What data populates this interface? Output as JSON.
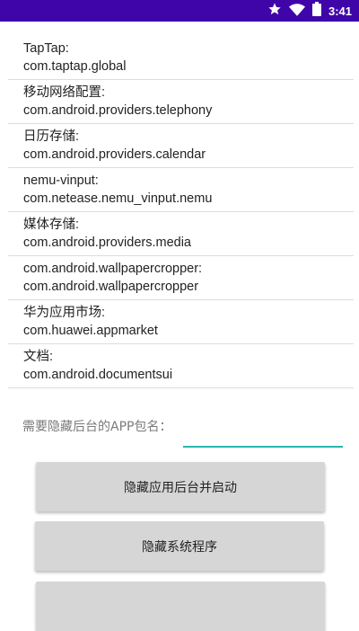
{
  "status_bar": {
    "time": "3:41",
    "color": "#3f05a8",
    "icons": [
      "star-icon",
      "wifi-icon",
      "battery-icon"
    ]
  },
  "apps": [
    {
      "label": "TapTap:",
      "package": "com.taptap.global"
    },
    {
      "label": "移动网络配置:",
      "package": "com.android.providers.telephony"
    },
    {
      "label": "日历存储:",
      "package": "com.android.providers.calendar"
    },
    {
      "label": "nemu-vinput:",
      "package": "com.netease.nemu_vinput.nemu"
    },
    {
      "label": "媒体存储:",
      "package": "com.android.providers.media"
    },
    {
      "label": "com.android.wallpapercropper:",
      "package": "com.android.wallpapercropper"
    },
    {
      "label": "华为应用市场:",
      "package": "com.huawei.appmarket"
    },
    {
      "label": "文档:",
      "package": "com.android.documentsui"
    }
  ],
  "form": {
    "package_label": "需要隐藏后台的APP包名：",
    "package_value": "",
    "accent": "#28b7ad"
  },
  "buttons": {
    "hide_and_launch": "隐藏应用后台并启动",
    "hide_system": "隐藏系统程序",
    "third": ""
  }
}
